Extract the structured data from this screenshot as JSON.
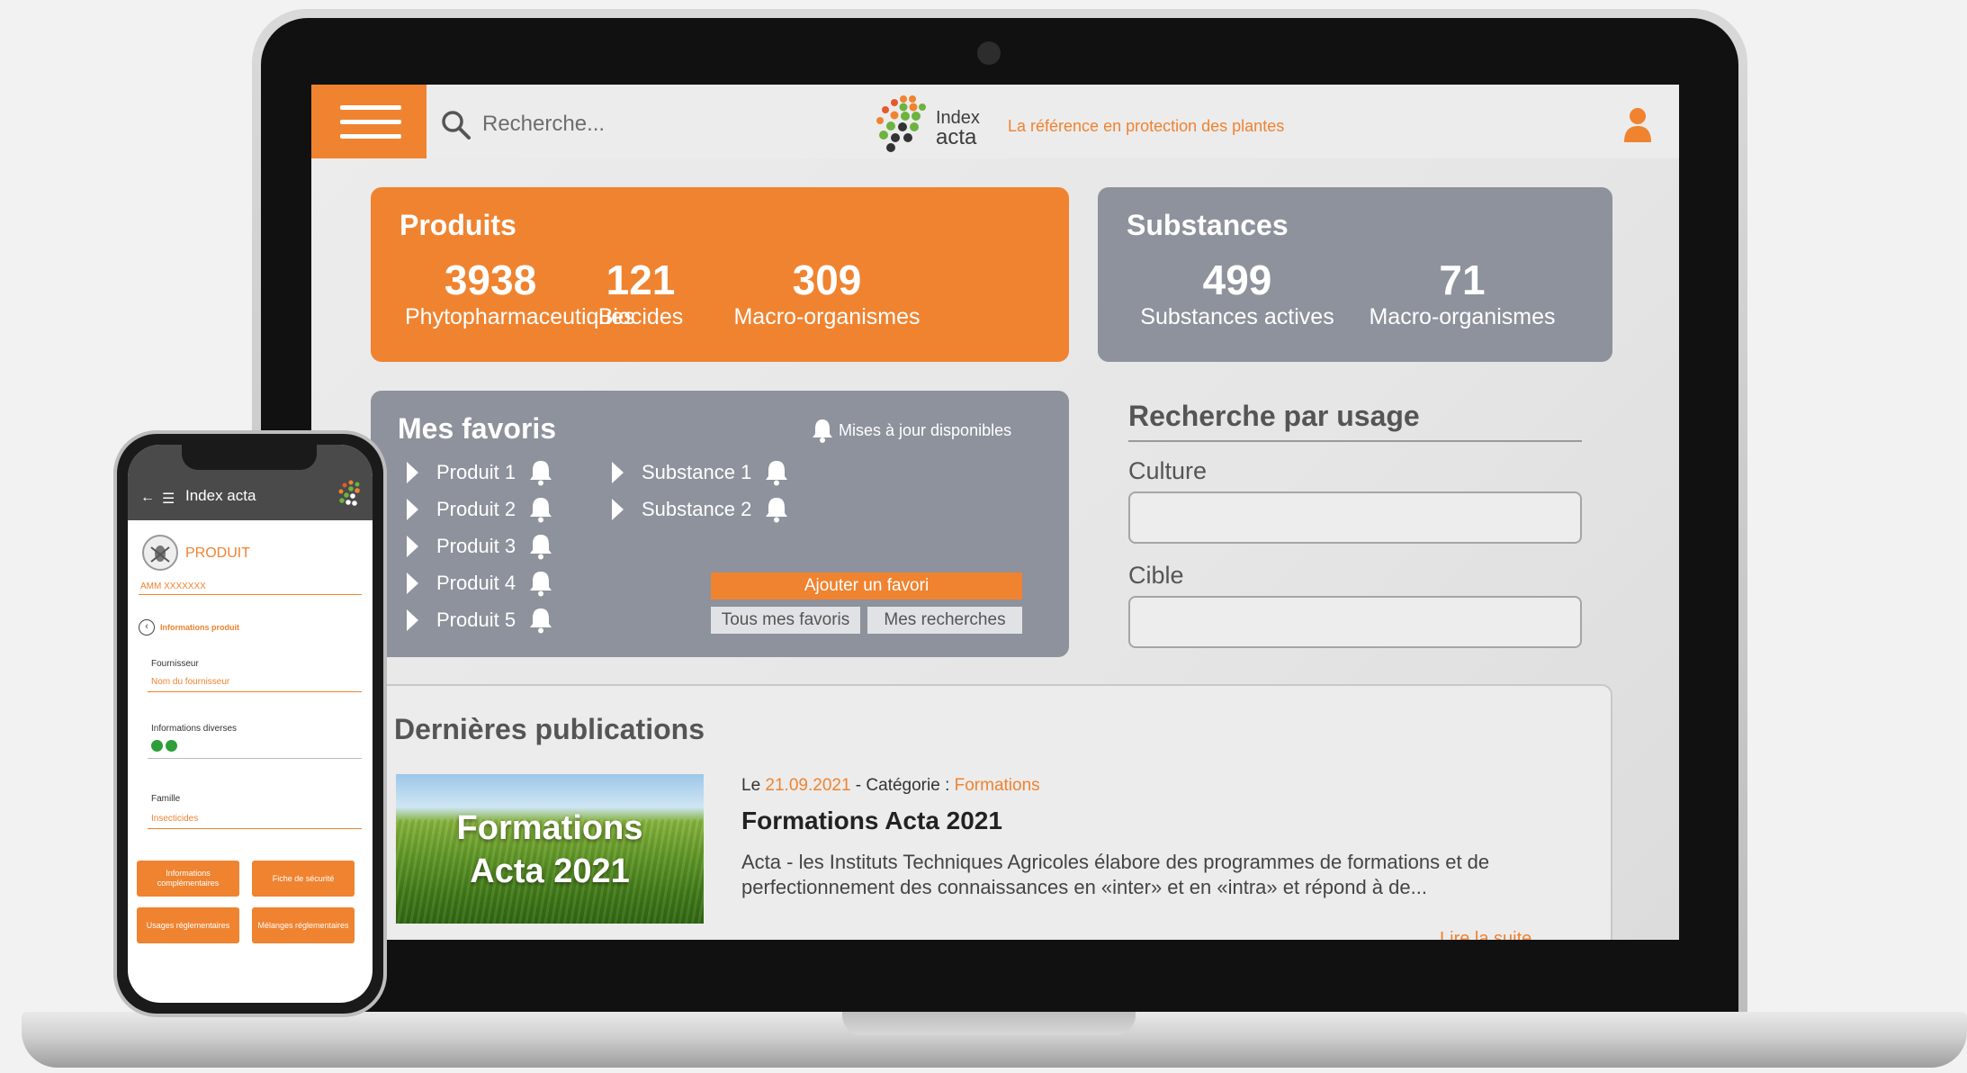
{
  "header": {
    "search_placeholder": "Recherche...",
    "logo_line1": "Index",
    "logo_line2": "acta",
    "tagline": "La référence en protection des plantes"
  },
  "produits": {
    "title": "Produits",
    "stats": [
      {
        "value": "3938",
        "label": "Phytopharmaceutiques"
      },
      {
        "value": "121",
        "label": "Biocides"
      },
      {
        "value": "309",
        "label": "Macro-organismes"
      }
    ]
  },
  "substances": {
    "title": "Substances",
    "stats": [
      {
        "value": "499",
        "label": "Substances actives"
      },
      {
        "value": "71",
        "label": "Macro-organismes"
      }
    ]
  },
  "favoris": {
    "title": "Mes favoris",
    "updates_label": "Mises à jour disponibles",
    "produits": [
      "Produit 1",
      "Produit 2",
      "Produit 3",
      "Produit 4",
      "Produit 5"
    ],
    "substances": [
      "Substance 1",
      "Substance 2"
    ],
    "add_button": "Ajouter un favori",
    "all_button": "Tous mes favoris",
    "searches_button": "Mes recherches"
  },
  "usage": {
    "title": "Recherche par usage",
    "culture_label": "Culture",
    "cible_label": "Cible"
  },
  "publications": {
    "title": "Dernières publications",
    "image_line1": "Formations",
    "image_line2": "Acta 2021",
    "meta_prefix": "Le",
    "date": "21.09.2021",
    "category_prefix": "- Catégorie :",
    "category": "Formations",
    "post_title": "Formations Acta 2021",
    "description": "Acta - les Instituts Techniques Agricoles élabore des programmes de formations et de perfectionnement des connaissances en «inter» et en «intra» et répond à de...",
    "read_more": "Lire la suite"
  },
  "phone": {
    "app_title": "Index acta",
    "product_heading": "PRODUIT",
    "amm": "AMM XXXXXXX",
    "info_section": "Informations produit",
    "fournisseur_label": "Fournisseur",
    "fournisseur_value": "Nom du fournisseur",
    "infos_label": "Informations diverses",
    "famille_label": "Famille",
    "famille_value": "Insecticides",
    "btn_infos": "Informations complémentaires",
    "btn_fiche": "Fiche de sécurité",
    "btn_usages": "Usages réglementaires",
    "btn_melanges": "Mélanges réglementaires"
  },
  "colors": {
    "accent": "#f08330",
    "card_grey": "#8d929c"
  }
}
